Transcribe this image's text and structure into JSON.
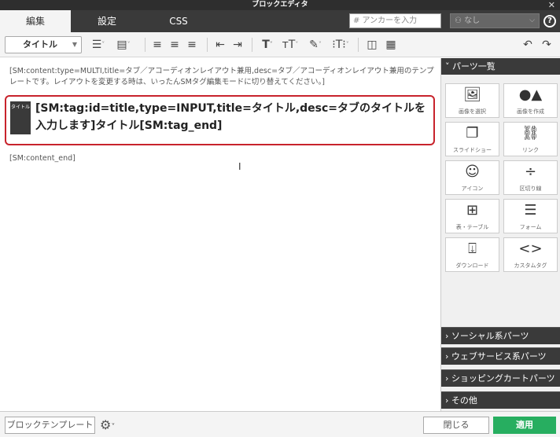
{
  "window": {
    "title": "ブロックエディタ"
  },
  "tabs": [
    {
      "label": "編集"
    },
    {
      "label": "設定"
    },
    {
      "label": "CSS"
    }
  ],
  "anchor": {
    "placeholder": "# アンカーを入力"
  },
  "template_select": {
    "value": "なし"
  },
  "toolbar": {
    "style_select": "タイトル"
  },
  "editor": {
    "content_tag": "[SM:content:type=MULTI,title=タブ／アコーディオンレイアウト兼用,desc=タブ／アコーディオンレイアウト兼用のテンプレートです。レイアウトを変更する時は、いったんSMタグ編集モードに切り替えてください。]",
    "block_badge": "タイトル",
    "block_text": "[SM:tag:id=title,type=INPUT,title=タイトル,desc=タブのタイトルを入力します]タイトル[SM:tag_end]",
    "content_end": "[SM:content_end]"
  },
  "sidebar": {
    "header": "パーツ一覧",
    "parts": [
      {
        "label": "画像を選択",
        "icon": "image-icon"
      },
      {
        "label": "画像を作成",
        "icon": "shapes-icon"
      },
      {
        "label": "スライドショー",
        "icon": "slideshow-icon"
      },
      {
        "label": "リンク",
        "icon": "link-icon"
      },
      {
        "label": "アイコン",
        "icon": "smiley-icon"
      },
      {
        "label": "区切り線",
        "icon": "divider-icon"
      },
      {
        "label": "表・テーブル",
        "icon": "table-icon"
      },
      {
        "label": "フォーム",
        "icon": "form-icon"
      },
      {
        "label": "ダウンロード",
        "icon": "download-icon"
      },
      {
        "label": "カスタムタグ",
        "icon": "code-icon"
      }
    ],
    "sections": [
      {
        "label": "ソーシャル系パーツ"
      },
      {
        "label": "ウェブサービス系パーツ"
      },
      {
        "label": "ショッピングカートパーツ"
      },
      {
        "label": "その他"
      }
    ]
  },
  "footer": {
    "template_button": "ブロックテンプレート",
    "close_button": "閉じる",
    "apply_button": "適用"
  },
  "colors": {
    "accent": "#27ae60",
    "block_border": "#c8232c",
    "dark": "#3a3a3a"
  }
}
